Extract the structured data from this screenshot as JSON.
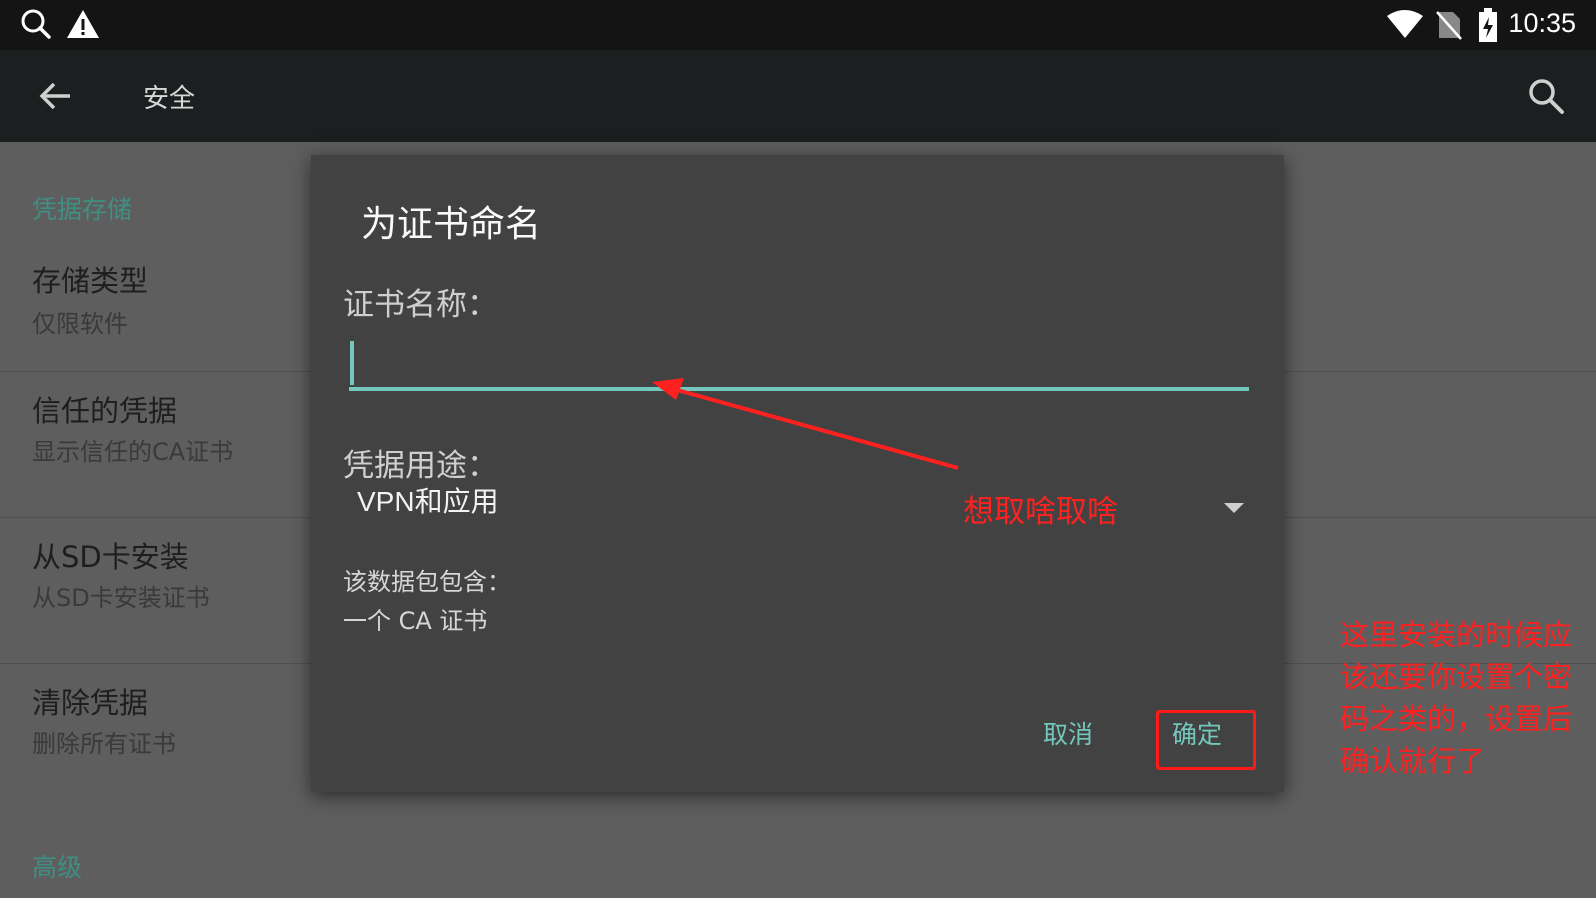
{
  "status_bar": {
    "time": "10:35",
    "left_icons": [
      "search-icon",
      "warning-icon"
    ],
    "right_icons": [
      "wifi-icon",
      "no-sim-icon",
      "battery-charging-icon"
    ]
  },
  "app_bar": {
    "title": "安全",
    "back_icon": "arrow-back-icon",
    "search_icon": "search-icon"
  },
  "background_list": {
    "section_credentials": "凭据存储",
    "items": [
      {
        "title": "存储类型",
        "subtitle": "仅限软件"
      },
      {
        "title": "信任的凭据",
        "subtitle": "显示信任的CA证书"
      },
      {
        "title": "从SD卡安装",
        "subtitle": "从SD卡安装证书"
      },
      {
        "title": "清除凭据",
        "subtitle": "删除所有证书"
      }
    ],
    "section_advanced": "高级"
  },
  "dialog": {
    "title": "为证书命名",
    "name_label": "证书名称：",
    "name_value": "",
    "usage_label": "凭据用途：",
    "usage_value": "VPN和应用",
    "info_label": "该数据包包含：",
    "info_value": "一个 CA 证书",
    "cancel_label": "取消",
    "ok_label": "确定"
  },
  "annotations": {
    "arrow_text": "想取啥取啥",
    "side_note": "这里安装的时候应该还要你设置个密码之类的，设置后确认就行了",
    "color": "#ff2020"
  },
  "colors": {
    "accent": "#74c7bc",
    "section_header": "#3f8f83",
    "dialog_bg": "#424242"
  }
}
